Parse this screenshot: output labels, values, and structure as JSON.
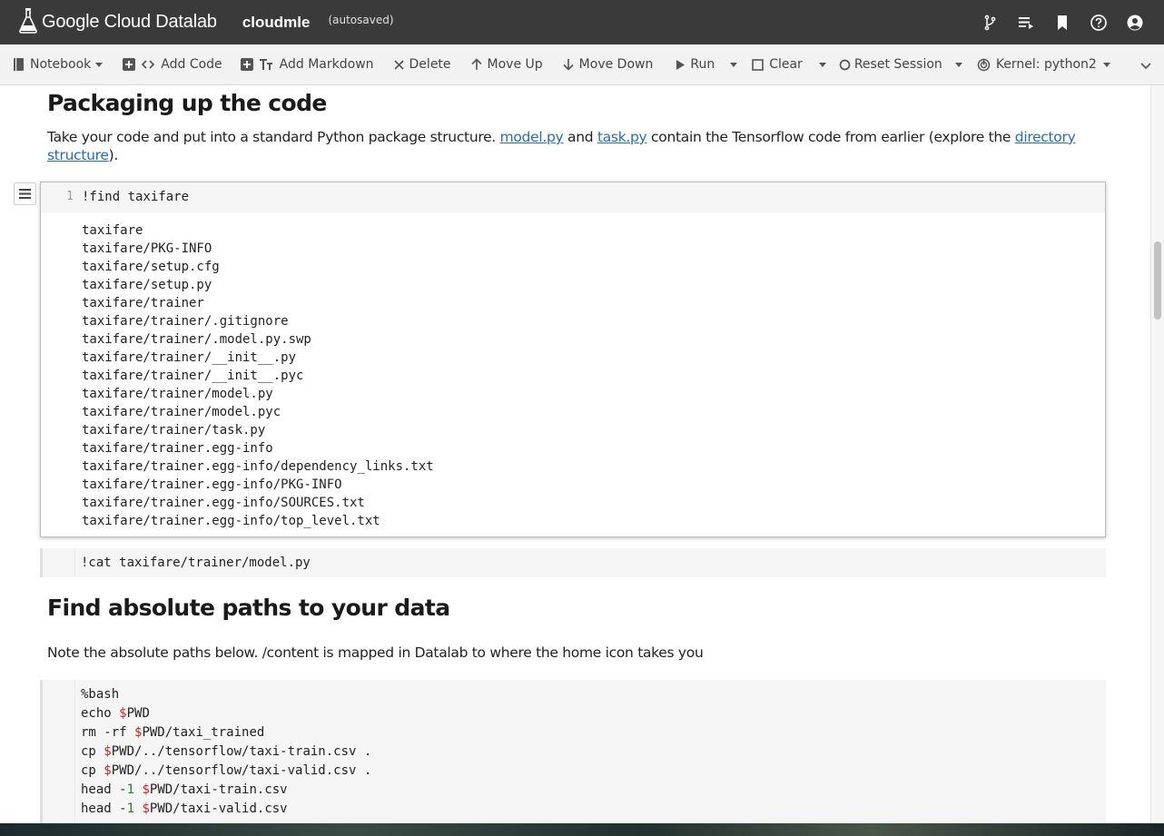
{
  "app": {
    "brand": "Google Cloud Datalab",
    "notebook_name": "cloudmle",
    "save_status": "(autosaved)"
  },
  "top_icons": [
    "branch-icon",
    "playlist-icon",
    "bookmark-icon",
    "help-icon",
    "account-icon"
  ],
  "toolbar": {
    "notebook": "Notebook",
    "add_code": "Add Code",
    "add_markdown": "Add Markdown",
    "delete": "Delete",
    "move_up": "Move Up",
    "move_down": "Move Down",
    "run": "Run",
    "clear": "Clear",
    "reset_session": "Reset Session",
    "kernel": "Kernel: python2"
  },
  "section1": {
    "heading": "Packaging up the code",
    "p_part1": "Take your code and put into a standard Python package structure.",
    "link1": "model.py",
    "p_part2": "and",
    "link2": "task.py",
    "p_part3": "contain the Tensorflow code from earlier (explore the",
    "link3": "directory structure",
    "p_part4": ")."
  },
  "cell1": {
    "line_number": "1",
    "code": "!find taxifare",
    "output": [
      "taxifare",
      "taxifare/PKG-INFO",
      "taxifare/setup.cfg",
      "taxifare/setup.py",
      "taxifare/trainer",
      "taxifare/trainer/.gitignore",
      "taxifare/trainer/.model.py.swp",
      "taxifare/trainer/__init__.py",
      "taxifare/trainer/__init__.pyc",
      "taxifare/trainer/model.py",
      "taxifare/trainer/model.pyc",
      "taxifare/trainer/task.py",
      "taxifare/trainer.egg-info",
      "taxifare/trainer.egg-info/dependency_links.txt",
      "taxifare/trainer.egg-info/PKG-INFO",
      "taxifare/trainer.egg-info/SOURCES.txt",
      "taxifare/trainer.egg-info/top_level.txt"
    ]
  },
  "cell2": {
    "code": "!cat taxifare/trainer/model.py"
  },
  "section2": {
    "heading": "Find absolute paths to your data",
    "paragraph": "Note the absolute paths below. /content is mapped in Datalab to where the home icon takes you"
  },
  "cell3": {
    "lines": [
      {
        "a": "%bash",
        "v": "",
        "n": "",
        "b": ""
      },
      {
        "a": "echo ",
        "v": "$",
        "n": "",
        "b": "PWD"
      },
      {
        "a": "rm -rf ",
        "v": "$",
        "n": "",
        "b": "PWD/taxi_trained"
      },
      {
        "a": "cp ",
        "v": "$",
        "n": "",
        "b": "PWD/../tensorflow/taxi-train.csv ."
      },
      {
        "a": "cp ",
        "v": "$",
        "n": "",
        "b": "PWD/../tensorflow/taxi-valid.csv ."
      },
      {
        "a": "head -",
        "n": "1",
        "v": "$",
        "b": "PWD/taxi-train.csv"
      },
      {
        "a": "head -",
        "n": "1",
        "v": "$",
        "b": "PWD/taxi-valid.csv"
      }
    ]
  }
}
